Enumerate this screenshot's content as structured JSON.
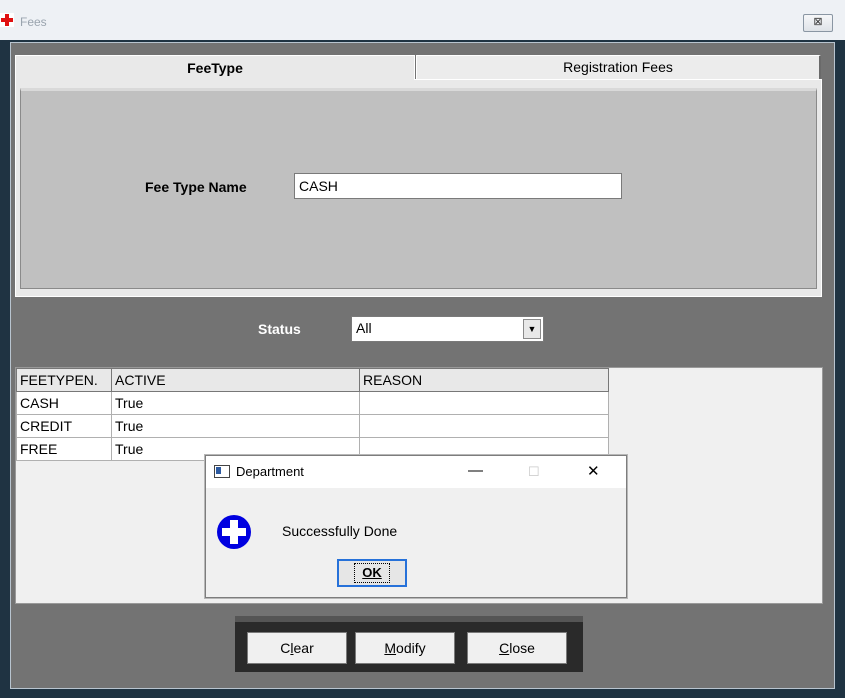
{
  "window": {
    "title": "Fees",
    "close_symbol": "⊠"
  },
  "tabs": [
    {
      "label": "FeeType",
      "selected": true
    },
    {
      "label": "Registration Fees",
      "selected": false
    }
  ],
  "form": {
    "fee_type_name_label": "Fee Type Name",
    "fee_type_name_value": "CASH",
    "status_label": "Status",
    "status_value": "All"
  },
  "grid": {
    "columns": [
      "FEETYPEN.",
      "ACTIVE",
      "REASON"
    ],
    "rows": [
      [
        "CASH",
        "True",
        ""
      ],
      [
        "CREDIT",
        "True",
        ""
      ],
      [
        "FREE",
        "True",
        ""
      ]
    ]
  },
  "buttons": {
    "clear": {
      "label": "Clear",
      "access_key_index": 1
    },
    "modify": {
      "label": "Modify",
      "access_key_index": 0
    },
    "close": {
      "label": "Close",
      "access_key_index": 0
    }
  },
  "dialog": {
    "title": "Department",
    "message": "Successfully Done",
    "ok_label": "OK",
    "icon": "plus-circle-icon",
    "minimize_symbol": "—",
    "maximize_symbol": "☐",
    "close_symbol": "✕"
  },
  "colors": {
    "dialog_icon_blue": "#0000e0",
    "app_icon_red": "#e01010",
    "ok_focus_border": "#2671d9"
  }
}
